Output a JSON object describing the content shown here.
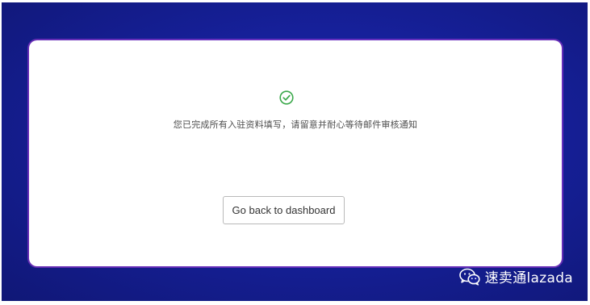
{
  "dialog": {
    "status_icon": "check-circle-icon",
    "message": "您已完成所有入驻资料填写，请留意并耐心等待邮件审核通知",
    "back_button_label": "Go back to dashboard"
  },
  "watermark": {
    "icon": "wechat-icon",
    "text": "速卖通lazada"
  },
  "colors": {
    "background": "#16209a",
    "card": "#ffffff",
    "success": "#3aa84a"
  }
}
